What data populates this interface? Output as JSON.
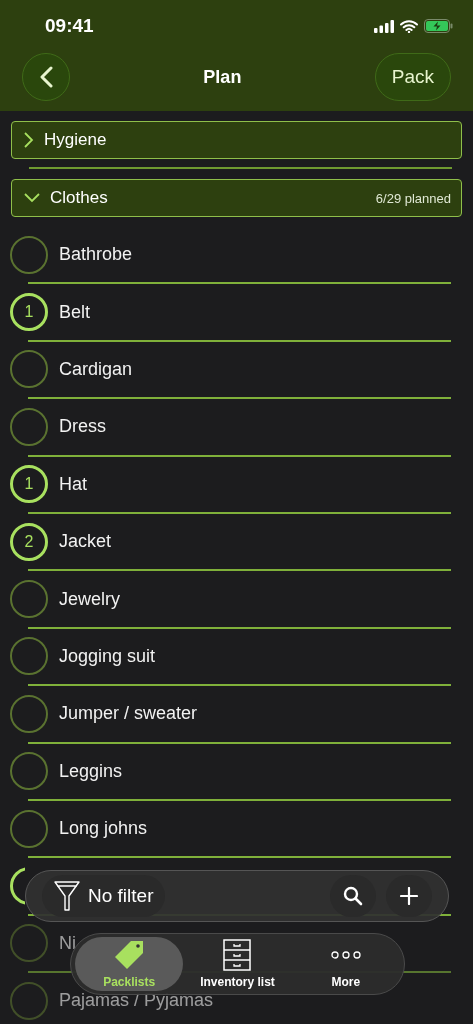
{
  "status_bar": {
    "time": "09:41"
  },
  "nav": {
    "title": "Plan",
    "action": "Pack"
  },
  "sections": [
    {
      "name": "Hygiene",
      "expanded": false
    },
    {
      "name": "Clothes",
      "expanded": true,
      "summary": "6/29 planned",
      "items": [
        {
          "kind": "item",
          "name": "Bathrobe",
          "planned": false
        },
        {
          "kind": "item",
          "name": "Belt",
          "planned": true,
          "count": "1"
        },
        {
          "kind": "item",
          "name": "Cardigan",
          "planned": false
        },
        {
          "kind": "item",
          "name": "Dress",
          "planned": false
        },
        {
          "kind": "item",
          "name": "Hat",
          "planned": true,
          "count": "1"
        },
        {
          "kind": "item",
          "name": "Jacket",
          "planned": true,
          "count": "2"
        },
        {
          "kind": "item",
          "name": "Jewelry",
          "planned": false
        },
        {
          "kind": "item",
          "name": "Jogging suit",
          "planned": false
        },
        {
          "kind": "item",
          "name": "Jumper / sweater",
          "planned": false
        },
        {
          "kind": "item",
          "name": "Leggins",
          "planned": false
        },
        {
          "kind": "item",
          "name": "Long johns",
          "planned": false
        },
        {
          "kind": "covered",
          "planned": true
        },
        {
          "kind": "dimmed",
          "name": "Ni",
          "planned": false
        },
        {
          "kind": "dimmed",
          "name": "Pajamas / Pyjamas",
          "planned": false
        }
      ]
    }
  ],
  "toolbar": {
    "filter": "No filter"
  },
  "tabs": [
    {
      "label": "Packlists",
      "selected": true
    },
    {
      "label": "Inventory list",
      "selected": false
    },
    {
      "label": "More",
      "selected": false
    }
  ]
}
